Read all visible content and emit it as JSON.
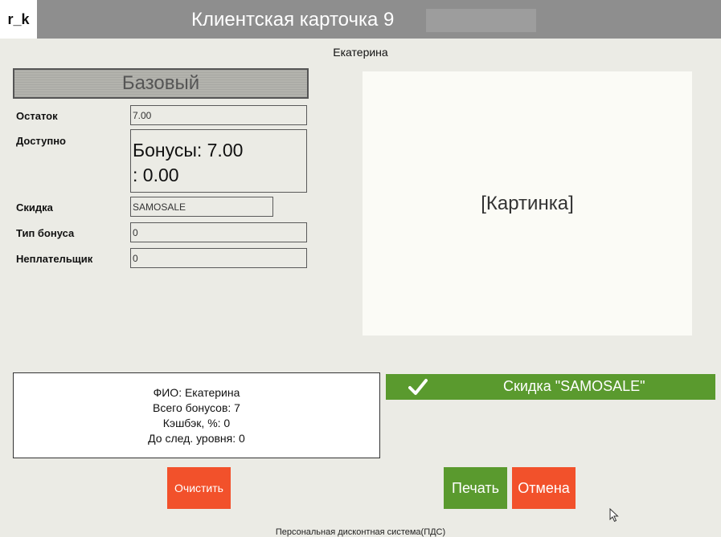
{
  "header": {
    "logo_text": "r_k",
    "title": "Клиентская карточка 9"
  },
  "client": {
    "name": "Екатерина"
  },
  "level": {
    "label": "Базовый"
  },
  "fields": {
    "balance": {
      "label": "Остаток",
      "value": "7.00"
    },
    "available": {
      "label": "Доступно",
      "line1": "Бонусы: 7.00",
      "line2": ": 0.00"
    },
    "discount": {
      "label": "Скидка",
      "value": "SAMOSALE"
    },
    "bonus_type": {
      "label": "Тип бонуса",
      "value": "0"
    },
    "non_payer": {
      "label": "Неплательщик",
      "value": "0"
    }
  },
  "picture": {
    "placeholder": "[Картинка]"
  },
  "summary": {
    "fio": "ФИО: Екатерина",
    "total_bonuses": "Всего бонусов: 7",
    "cashback": "Кэшбэк, %: 0",
    "next_level": "До след. уровня: 0"
  },
  "discount_status": {
    "text": "Скидка \"SAMOSALE\"",
    "icon": "check-icon"
  },
  "buttons": {
    "clear": "Очистить",
    "print": "Печать",
    "cancel": "Отмена"
  },
  "footer": {
    "text": "Персональная дисконтная система(ПДС)"
  },
  "colors": {
    "title_bar": "#8e8e8e",
    "background": "#ebebe5",
    "accent_green": "#5a9a2e",
    "accent_red": "#f2512b"
  }
}
